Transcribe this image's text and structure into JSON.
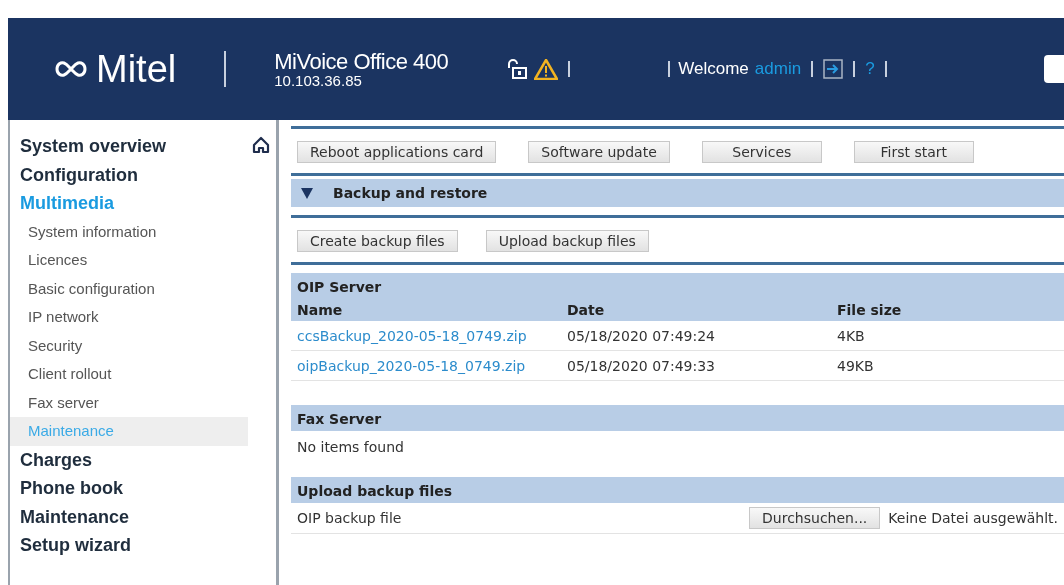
{
  "header": {
    "brand": "Mitel",
    "product": "MiVoice Office 400",
    "address": "10.103.36.85",
    "welcome": "Welcome",
    "user": "admin",
    "help": "?"
  },
  "nav": [
    {
      "label": "System overview",
      "kind": "group",
      "expanded": false,
      "selected": false
    },
    {
      "label": "Configuration",
      "kind": "group",
      "expanded": false,
      "selected": false
    },
    {
      "label": "Multimedia",
      "kind": "group",
      "expanded": true,
      "selected": false
    },
    {
      "label": "System information",
      "kind": "sub",
      "selected": false
    },
    {
      "label": "Licences",
      "kind": "sub",
      "selected": false
    },
    {
      "label": "Basic configuration",
      "kind": "sub",
      "selected": false
    },
    {
      "label": "IP network",
      "kind": "sub",
      "selected": false
    },
    {
      "label": "Security",
      "kind": "sub",
      "selected": false
    },
    {
      "label": "Client rollout",
      "kind": "sub",
      "selected": false
    },
    {
      "label": "Fax server",
      "kind": "sub",
      "selected": false
    },
    {
      "label": "Maintenance",
      "kind": "sub",
      "selected": true
    },
    {
      "label": "Charges",
      "kind": "group",
      "expanded": false,
      "selected": false
    },
    {
      "label": "Phone book",
      "kind": "group",
      "expanded": false,
      "selected": false
    },
    {
      "label": "Maintenance",
      "kind": "group",
      "expanded": false,
      "selected": false
    },
    {
      "label": "Setup wizard",
      "kind": "group",
      "expanded": false,
      "selected": false
    }
  ],
  "actions": [
    "Reboot applications card",
    "Software update",
    "Services",
    "First start"
  ],
  "section": {
    "title": "Backup and restore",
    "expanded": true
  },
  "backup_actions": [
    "Create backup files",
    "Upload backup files"
  ],
  "oip_server": {
    "title": "OIP Server",
    "columns": [
      "Name",
      "Date",
      "File size"
    ],
    "rows": [
      [
        "ccsBackup_2020-05-18_0749.zip",
        "05/18/2020 07:49:24",
        "4KB"
      ],
      [
        "oipBackup_2020-05-18_0749.zip",
        "05/18/2020 07:49:33",
        "49KB"
      ]
    ]
  },
  "fax_server": {
    "title": "Fax Server",
    "empty": "No items found"
  },
  "upload": {
    "title": "Upload backup files",
    "rows": [
      {
        "label": "OIP backup file",
        "button": "Durchsuchen...",
        "status": "Keine Datei ausgewählt."
      }
    ]
  }
}
